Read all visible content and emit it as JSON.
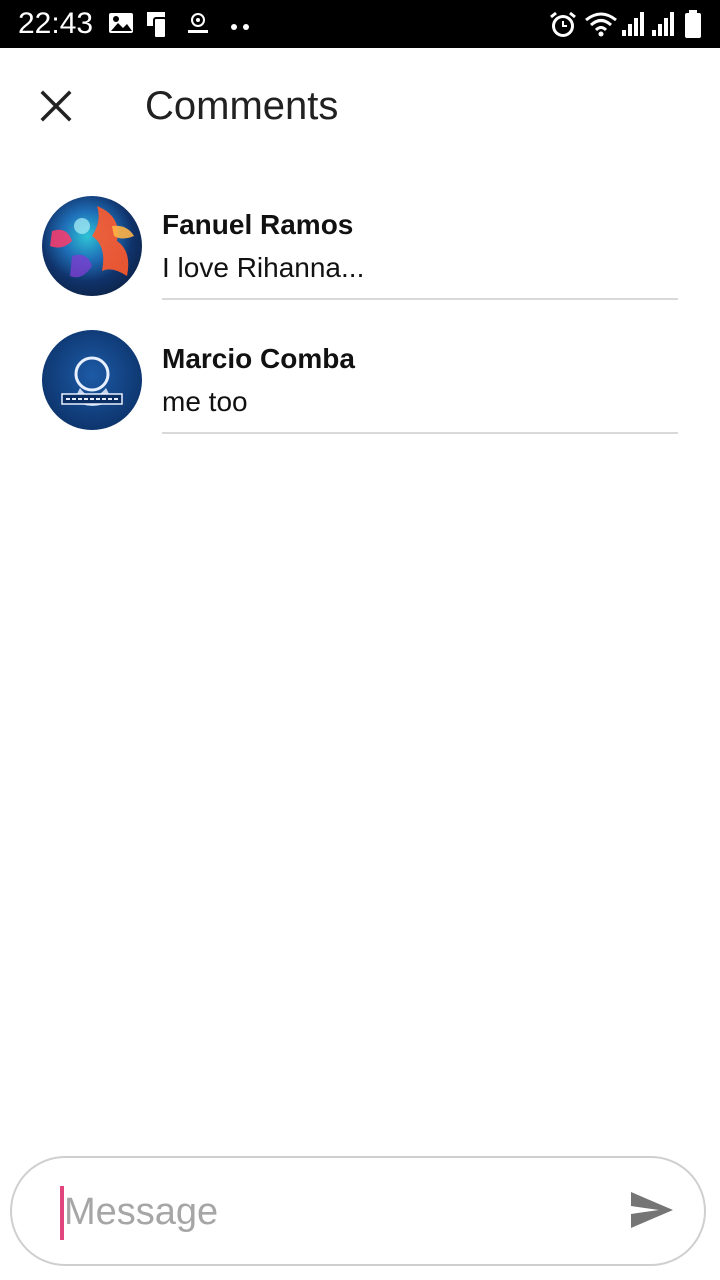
{
  "status_bar": {
    "time": "22:43",
    "left_icons": [
      "image-icon",
      "phone-icon",
      "app-icon",
      "more-dots-icon"
    ],
    "right_icons": [
      "alarm-icon",
      "wifi-icon",
      "signal-icon",
      "signal-icon",
      "battery-icon"
    ]
  },
  "header": {
    "close_icon": "close-icon",
    "title": "Comments"
  },
  "comments": [
    {
      "author": "Fanuel Ramos",
      "text": "I love Rihanna..."
    },
    {
      "author": "Marcio Comba",
      "text": "me too"
    }
  ],
  "composer": {
    "placeholder": "Message",
    "send_icon": "send-icon"
  },
  "colors": {
    "status_bar_bg": "#000000",
    "cursor_accent": "#e0457b",
    "divider": "#d9d9d9",
    "send_icon": "#757575"
  }
}
